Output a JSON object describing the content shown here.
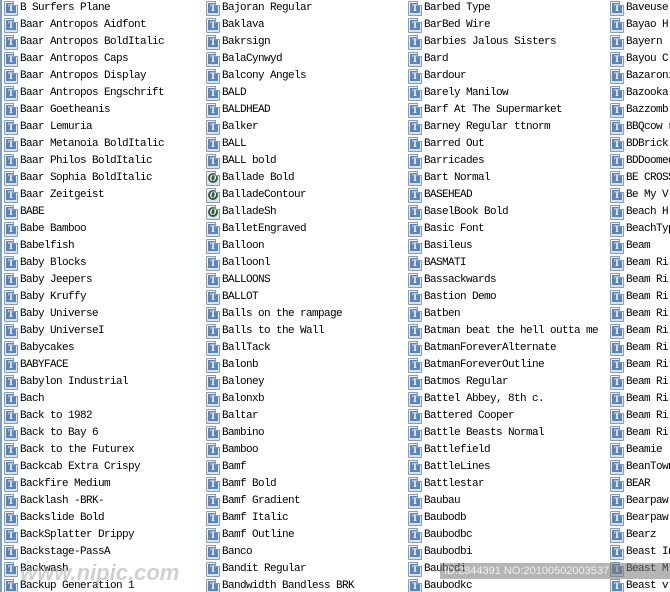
{
  "list_view": {
    "columns": [
      {
        "items": [
          {
            "name": "B Surfers Plane",
            "type": "truetype"
          },
          {
            "name": "Baar Antropos Aidfont",
            "type": "truetype"
          },
          {
            "name": "Baar Antropos BoldItalic",
            "type": "truetype"
          },
          {
            "name": "Baar Antropos Caps",
            "type": "truetype"
          },
          {
            "name": "Baar Antropos Display",
            "type": "truetype"
          },
          {
            "name": "Baar Antropos Engschrift",
            "type": "truetype"
          },
          {
            "name": "Baar Goetheanis",
            "type": "truetype"
          },
          {
            "name": "Baar Lemuria",
            "type": "truetype"
          },
          {
            "name": "Baar Metanoia BoldItalic",
            "type": "truetype"
          },
          {
            "name": "Baar Philos BoldItalic",
            "type": "truetype"
          },
          {
            "name": "Baar Sophia BoldItalic",
            "type": "truetype"
          },
          {
            "name": "Baar Zeitgeist",
            "type": "truetype"
          },
          {
            "name": "BABE",
            "type": "truetype"
          },
          {
            "name": "Babe Bamboo",
            "type": "truetype"
          },
          {
            "name": "Babelfish",
            "type": "truetype"
          },
          {
            "name": "Baby Blocks",
            "type": "truetype"
          },
          {
            "name": "Baby Jeepers",
            "type": "truetype"
          },
          {
            "name": "Baby Kruffy",
            "type": "truetype"
          },
          {
            "name": "Baby Universe",
            "type": "truetype"
          },
          {
            "name": "Baby UniverseI",
            "type": "truetype"
          },
          {
            "name": "Babycakes",
            "type": "truetype"
          },
          {
            "name": "BABYFACE",
            "type": "truetype"
          },
          {
            "name": "Babylon Industrial",
            "type": "truetype"
          },
          {
            "name": "Bach",
            "type": "truetype"
          },
          {
            "name": "Back to 1982",
            "type": "truetype"
          },
          {
            "name": "Back to Bay 6",
            "type": "truetype"
          },
          {
            "name": "Back to the Futurex",
            "type": "truetype"
          },
          {
            "name": "Backcab Extra Crispy",
            "type": "truetype"
          },
          {
            "name": "Backfire Medium",
            "type": "truetype"
          },
          {
            "name": "Backlash -BRK-",
            "type": "truetype"
          },
          {
            "name": "Backslide Bold",
            "type": "truetype"
          },
          {
            "name": "BackSplatter Drippy",
            "type": "truetype"
          },
          {
            "name": "Backstage-PassA",
            "type": "truetype"
          },
          {
            "name": "Backwash",
            "type": "truetype"
          },
          {
            "name": "Backup Generation 1",
            "type": "truetype"
          }
        ]
      },
      {
        "items": [
          {
            "name": "Bajoran Regular",
            "type": "truetype"
          },
          {
            "name": "Baklava",
            "type": "truetype"
          },
          {
            "name": "Bakrsign",
            "type": "truetype"
          },
          {
            "name": "BalaCynwyd",
            "type": "truetype"
          },
          {
            "name": "Balcony Angels",
            "type": "truetype"
          },
          {
            "name": "BALD",
            "type": "truetype"
          },
          {
            "name": "BALDHEAD",
            "type": "truetype"
          },
          {
            "name": "Balker",
            "type": "truetype"
          },
          {
            "name": "BALL",
            "type": "truetype"
          },
          {
            "name": "BALL bold",
            "type": "truetype"
          },
          {
            "name": "Ballade Bold",
            "type": "opentype"
          },
          {
            "name": "BalladeContour",
            "type": "opentype"
          },
          {
            "name": "BalladeSh",
            "type": "opentype"
          },
          {
            "name": "BalletEngraved",
            "type": "truetype"
          },
          {
            "name": "Balloon",
            "type": "truetype"
          },
          {
            "name": "Balloonl",
            "type": "truetype"
          },
          {
            "name": "BALLOONS",
            "type": "truetype"
          },
          {
            "name": "BALLOT",
            "type": "truetype"
          },
          {
            "name": "Balls on the rampage",
            "type": "truetype"
          },
          {
            "name": "Balls to the Wall",
            "type": "truetype"
          },
          {
            "name": "BallTack",
            "type": "truetype"
          },
          {
            "name": "Balonb",
            "type": "truetype"
          },
          {
            "name": "Baloney",
            "type": "truetype"
          },
          {
            "name": "Balonxb",
            "type": "truetype"
          },
          {
            "name": "Baltar",
            "type": "truetype"
          },
          {
            "name": "Bambino",
            "type": "truetype"
          },
          {
            "name": "Bamboo",
            "type": "truetype"
          },
          {
            "name": "Bamf",
            "type": "truetype"
          },
          {
            "name": "Bamf Bold",
            "type": "truetype"
          },
          {
            "name": "Bamf Gradient",
            "type": "truetype"
          },
          {
            "name": "Bamf Italic",
            "type": "truetype"
          },
          {
            "name": "Bamf Outline",
            "type": "truetype"
          },
          {
            "name": "Banco",
            "type": "truetype"
          },
          {
            "name": "Bandit Regular",
            "type": "truetype"
          },
          {
            "name": "Bandwidth Bandless BRK",
            "type": "truetype"
          }
        ]
      },
      {
        "items": [
          {
            "name": "Barbed Type",
            "type": "truetype"
          },
          {
            "name": "BarBed Wire",
            "type": "truetype"
          },
          {
            "name": "Barbies Jalous Sisters",
            "type": "truetype"
          },
          {
            "name": "Bard",
            "type": "truetype"
          },
          {
            "name": "Bardour",
            "type": "truetype"
          },
          {
            "name": "Barely Manilow",
            "type": "truetype"
          },
          {
            "name": "Barf At The Supermarket",
            "type": "truetype"
          },
          {
            "name": "Barney Regular ttnorm",
            "type": "truetype"
          },
          {
            "name": "Barred Out",
            "type": "truetype"
          },
          {
            "name": "Barricades",
            "type": "truetype"
          },
          {
            "name": "Bart Normal",
            "type": "truetype"
          },
          {
            "name": "BASEHEAD",
            "type": "truetype"
          },
          {
            "name": "BaselBook Bold",
            "type": "truetype"
          },
          {
            "name": "Basic Font",
            "type": "truetype"
          },
          {
            "name": "Basileus",
            "type": "truetype"
          },
          {
            "name": "BASMATI",
            "type": "truetype"
          },
          {
            "name": "Bassackwards",
            "type": "truetype"
          },
          {
            "name": "Bastion Demo",
            "type": "truetype"
          },
          {
            "name": "Batben",
            "type": "truetype"
          },
          {
            "name": "Batman beat the hell outta me",
            "type": "truetype"
          },
          {
            "name": "BatmanForeverAlternate",
            "type": "truetype"
          },
          {
            "name": "BatmanForeverOutline",
            "type": "truetype"
          },
          {
            "name": "Batmos Regular",
            "type": "truetype"
          },
          {
            "name": "Battel Abbey, 8th c.",
            "type": "truetype"
          },
          {
            "name": "Battered Cooper",
            "type": "truetype"
          },
          {
            "name": "Battle Beasts Normal",
            "type": "truetype"
          },
          {
            "name": "Battlefield",
            "type": "truetype"
          },
          {
            "name": "BattleLines",
            "type": "truetype"
          },
          {
            "name": "Battlestar",
            "type": "truetype"
          },
          {
            "name": "Baubau",
            "type": "truetype"
          },
          {
            "name": "Baubodb",
            "type": "truetype"
          },
          {
            "name": "Baubodbc",
            "type": "truetype"
          },
          {
            "name": "Baubodbi",
            "type": "truetype"
          },
          {
            "name": "Baubodi",
            "type": "truetype"
          },
          {
            "name": "Baubodkc",
            "type": "truetype"
          }
        ]
      },
      {
        "items": [
          {
            "name": "Baveuse",
            "type": "truetype"
          },
          {
            "name": "Bayao H",
            "type": "truetype"
          },
          {
            "name": "Bayern",
            "type": "truetype"
          },
          {
            "name": "Bayou C",
            "type": "truetype"
          },
          {
            "name": "Bazaroni",
            "type": "truetype"
          },
          {
            "name": "Bazooka",
            "type": "truetype"
          },
          {
            "name": "Bazzomb",
            "type": "truetype"
          },
          {
            "name": "BBQcow r",
            "type": "truetype"
          },
          {
            "name": "BDBrick",
            "type": "truetype"
          },
          {
            "name": "BDDoomed",
            "type": "truetype"
          },
          {
            "name": "BE CROSS",
            "type": "truetype"
          },
          {
            "name": "Be My V",
            "type": "truetype"
          },
          {
            "name": "Beach H",
            "type": "truetype"
          },
          {
            "name": "BeachTyp",
            "type": "truetype"
          },
          {
            "name": "Beam",
            "type": "truetype"
          },
          {
            "name": "Beam Ri",
            "type": "truetype"
          },
          {
            "name": "Beam Ri",
            "type": "truetype"
          },
          {
            "name": "Beam Ri",
            "type": "truetype"
          },
          {
            "name": "Beam Ri",
            "type": "truetype"
          },
          {
            "name": "Beam Ri",
            "type": "truetype"
          },
          {
            "name": "Beam Ri",
            "type": "truetype"
          },
          {
            "name": "Beam Ri",
            "type": "truetype"
          },
          {
            "name": "Beam Ri",
            "type": "truetype"
          },
          {
            "name": "Beam Ri",
            "type": "truetype"
          },
          {
            "name": "Beam Ri",
            "type": "truetype"
          },
          {
            "name": "Beam Ri",
            "type": "truetype"
          },
          {
            "name": "Beamie",
            "type": "truetype"
          },
          {
            "name": "BeanTown",
            "type": "truetype"
          },
          {
            "name": "BEAR",
            "type": "truetype"
          },
          {
            "name": "Bearpaw",
            "type": "truetype"
          },
          {
            "name": "Bearpaw",
            "type": "truetype"
          },
          {
            "name": "Bearz",
            "type": "truetype"
          },
          {
            "name": "Beast In",
            "type": "truetype"
          },
          {
            "name": "Beast M",
            "type": "truetype"
          },
          {
            "name": "Beast v",
            "type": "truetype"
          }
        ]
      }
    ],
    "icon_glyphs": {
      "truetype": "T",
      "opentype": "O"
    }
  },
  "watermark": {
    "id_text": "ID:2844391 NO:20100502003537",
    "site_text": "www.nipic.com"
  }
}
